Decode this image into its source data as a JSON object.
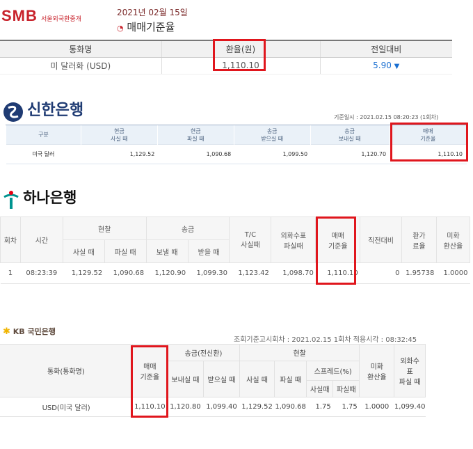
{
  "smb": {
    "logo_text": "SMB",
    "logo_sub": "서울외국환중개",
    "date": "2021년  02월  15일",
    "title": "매매기준율",
    "headers": [
      "통화명",
      "환율(원)",
      "전일대비"
    ],
    "row": {
      "currency": "미 달러화 (USD)",
      "rate": "1,110.10",
      "change": "5.90"
    },
    "colors": {
      "brand": "#c8232c",
      "down": "#1a6fd1"
    }
  },
  "shinhan": {
    "logo_text": "신한은행",
    "basis": "기준일시 : 2021.02.15 08:20:23 (1회차)",
    "headers": [
      {
        "l1": "구분",
        "l2": ""
      },
      {
        "l1": "현금",
        "l2": "사실 때"
      },
      {
        "l1": "현금",
        "l2": "파실 때"
      },
      {
        "l1": "송금",
        "l2": "받으실 때"
      },
      {
        "l1": "송금",
        "l2": "보내실 때"
      },
      {
        "l1": "매매",
        "l2": "기준율"
      }
    ],
    "row": [
      "미국 달러",
      "1,129.52",
      "1,090.68",
      "1,099.50",
      "1,120.70",
      "1,110.10"
    ]
  },
  "hana": {
    "logo_text": "하나은행",
    "headers": {
      "round": "회차",
      "time": "시간",
      "cash": "현찰",
      "wire": "송금",
      "tc": "T/C",
      "tc2": "사실때",
      "check": "외화수표",
      "check2": "파실때",
      "base": "매매",
      "base2": "기준율",
      "prev": "직전대비",
      "conv": "환가",
      "conv2": "료율",
      "usd": "미화",
      "usd2": "환산율",
      "buy": "사실 때",
      "sell": "파실 때",
      "send": "보낼 때",
      "recv": "받을 때"
    },
    "row": [
      "1",
      "08:23:39",
      "1,129.52",
      "1,090.68",
      "1,120.90",
      "1,099.30",
      "1,123.42",
      "1,098.70",
      "1,110.10",
      "0",
      "1.95738",
      "1.0000"
    ]
  },
  "kb": {
    "logo_text": "KB 국민은행",
    "basis": "조회기준고시회차 : 2021.02.15  1회차  적용시각 : 08:32:45",
    "headers": {
      "currency": "통화(통화명)",
      "base": "매매",
      "base2": "기준율",
      "wire": "송금(전신환)",
      "cash": "현찰",
      "send": "보내실 때",
      "recv": "받으실 때",
      "buy": "사실 때",
      "sell": "파실 때",
      "spread": "스프레드(%)",
      "sp_buy": "사실때",
      "sp_sell": "파실때",
      "usd": "미화",
      "usd2": "환산율",
      "check": "외화수",
      "check2": "표",
      "check3": "파실 때"
    },
    "row": [
      "USD(미국 달러)",
      "1,110.10",
      "1,120.80",
      "1,099.40",
      "1,129.52",
      "1,090.68",
      "1.75",
      "1.75",
      "1.0000",
      "1,099.40"
    ]
  }
}
